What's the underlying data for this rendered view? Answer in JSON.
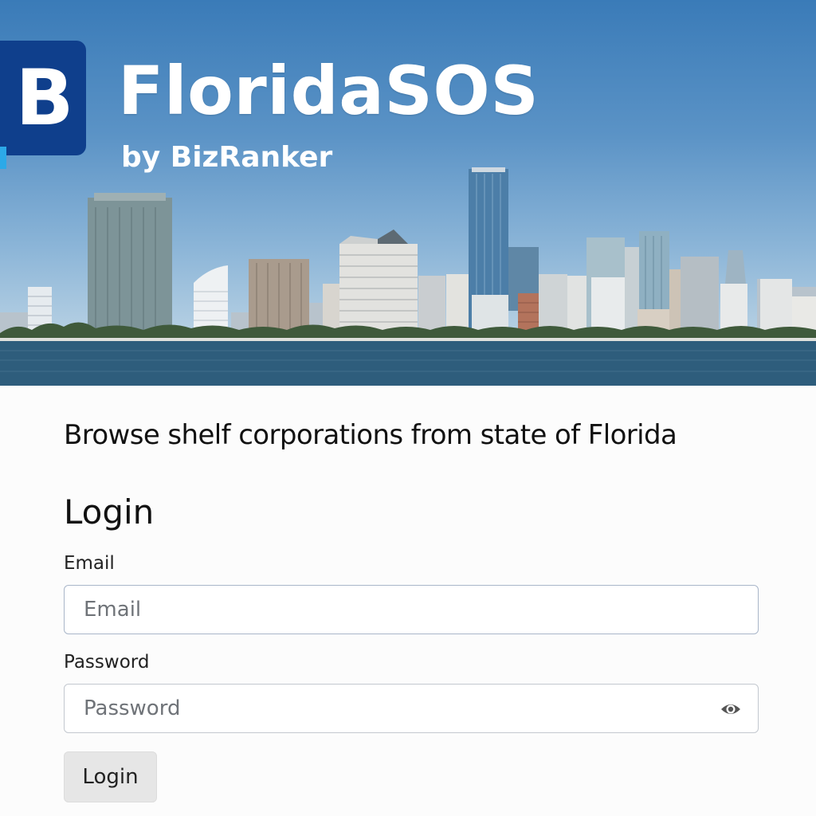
{
  "header": {
    "logo_letter": "B",
    "title": "FloridaSOS",
    "subtitle": "by BizRanker",
    "brand_color": "#0f3f8c",
    "accent_color": "#2ca9e8"
  },
  "main": {
    "tagline": "Browse shelf corporations from state of Florida",
    "heading": "Login",
    "email": {
      "label": "Email",
      "placeholder": "Email",
      "value": ""
    },
    "password": {
      "label": "Password",
      "placeholder": "Password",
      "value": "",
      "toggle_icon": "eye-icon"
    },
    "submit_label": "Login"
  }
}
